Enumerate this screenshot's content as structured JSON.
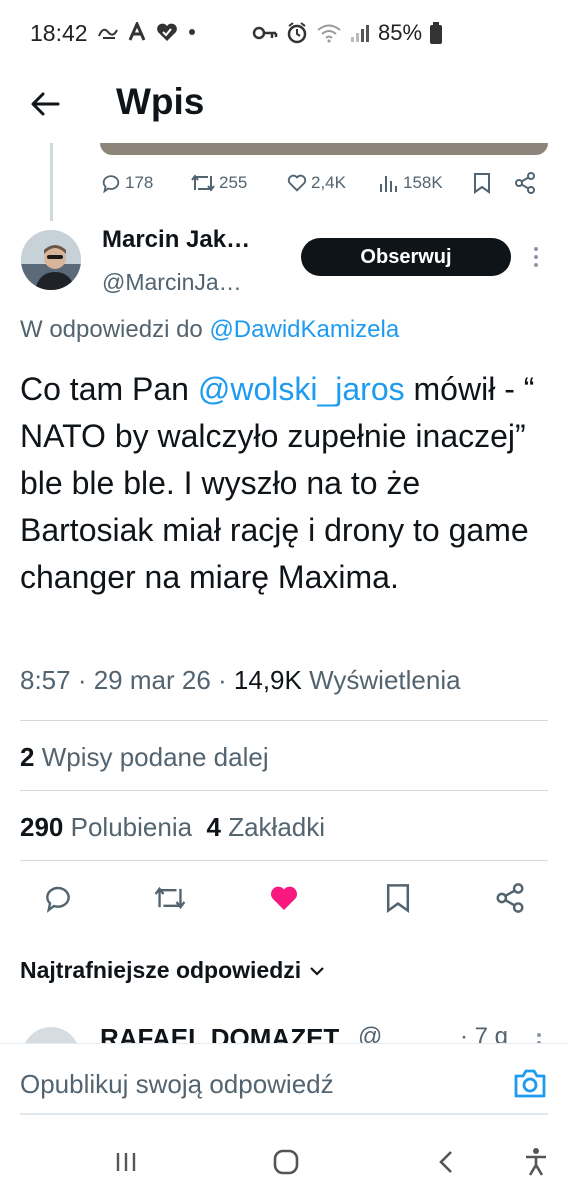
{
  "status_bar": {
    "time": "18:42",
    "battery": "85%",
    "left_icons": [
      "tl-icon",
      "a-icon",
      "heart-check-icon",
      "dot-icon"
    ],
    "right_icons": [
      "key-icon",
      "alarm-icon",
      "wifi-icon",
      "signal-icon",
      "battery-icon"
    ]
  },
  "header": {
    "title": "Wpis"
  },
  "previous_tweet_actions": {
    "replies": "178",
    "reposts": "255",
    "likes": "2,4K",
    "views": "158K"
  },
  "tweet": {
    "author_name": "Marcin Jak…",
    "author_handle": "@MarcinJa…",
    "follow_label": "Obserwuj",
    "reply_prefix": "W odpowiedzi do ",
    "reply_to_handle": "@DawidKamizela",
    "text_before_mention": "Co tam Pan ",
    "mention": "@wolski_jaros",
    "text_after_mention": " mówił - “ NATO by walczyło zupełnie inaczej” ble ble ble. I wyszło na to że Bartosiak miał rację i drony to game changer na miarę Maxima.",
    "time": "8:57",
    "date": "29 mar 26",
    "views_count": "14,9K",
    "views_label": "Wyświetlenia",
    "reposts_count": "2",
    "reposts_label": "Wpisy podane dalej",
    "likes_count": "290",
    "likes_label": "Polubienia",
    "bookmarks_count": "4",
    "bookmarks_label": "Zakładki",
    "liked": true,
    "like_color": "#f91880"
  },
  "replies_sort": {
    "label": "Najtrafniejsze odpowiedzi"
  },
  "next_reply": {
    "name": "RAFAEL DOMAZET",
    "handle": "@",
    "time": "· 7 g"
  },
  "compose": {
    "placeholder": "Opublikuj swoją odpowiedź"
  },
  "colors": {
    "accent": "#1d9bf0",
    "text_primary": "#0f1419",
    "text_secondary": "#536471"
  }
}
